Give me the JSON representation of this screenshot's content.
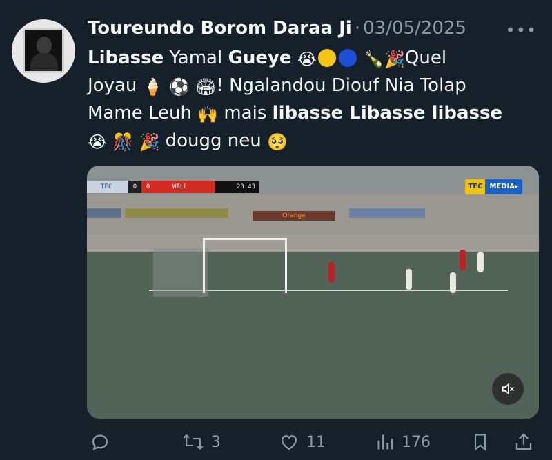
{
  "tweet": {
    "author_name": "Toureundo Borom Daraa Ji",
    "separator": "·",
    "date": "03/05/2025",
    "more_label": "•••",
    "text": {
      "w1": "Libasse",
      "w2": " Yamal ",
      "w3": "Gueye",
      "w4": "Quel",
      "w5": "Joyau",
      "w6": "! Ngalandou Diouf Nia Tolap",
      "w7": "Mame Leuh",
      "w8": " mais ",
      "w9": "libasse Libasse libasse",
      "w10": " dougg neu"
    },
    "emojis": {
      "sob": "😭",
      "champagne": "🍾",
      "party": "🎉",
      "ice_cream": "🍦",
      "soccer": "⚽",
      "stadium": "🏟",
      "raised_hands": "🙌",
      "confetti": "🎊",
      "pleading": "🥺"
    },
    "circle_colors": {
      "yellow": "#f5c518",
      "blue": "#1d4fd8"
    }
  },
  "video": {
    "score_team1": "TFC",
    "score_1": "0",
    "score_2": "0",
    "score_team2": "WALL",
    "score_time": "23:43",
    "logo_tfc": "TFC",
    "logo_media": "MEDIA▸",
    "board_text": "Orange",
    "mute_icon": "volume-muted-icon"
  },
  "actions": {
    "reply_count": "",
    "retweet_count": "3",
    "like_count": "11",
    "views_count": "176"
  },
  "colors": {
    "background": "#15202b",
    "text": "#f7f9f9",
    "muted": "#8b98a5"
  }
}
